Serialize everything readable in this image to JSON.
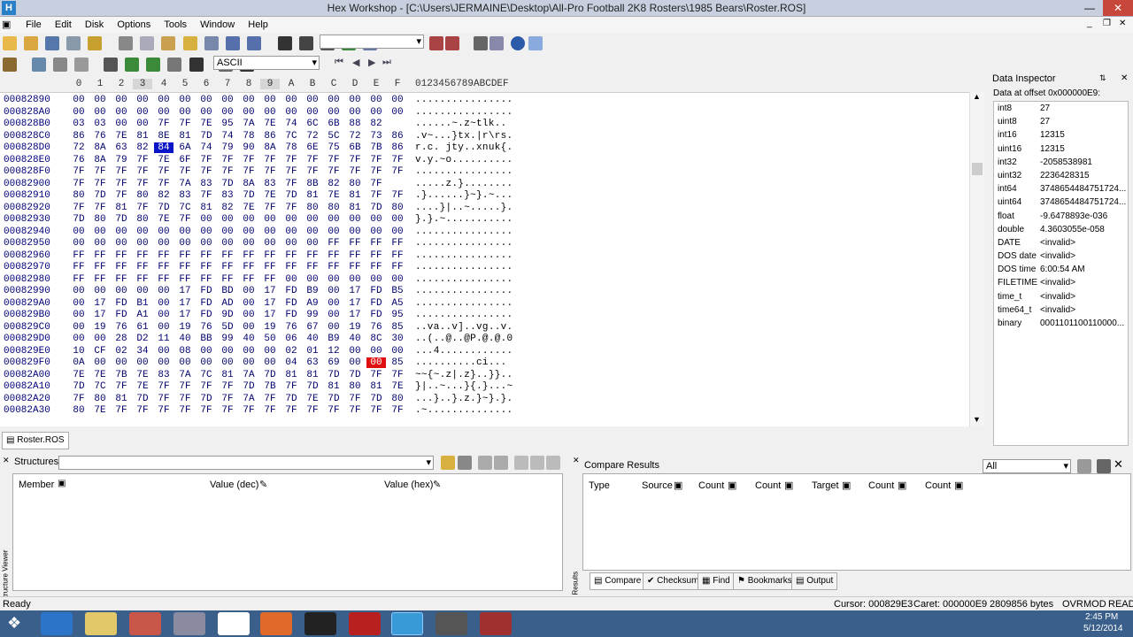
{
  "window": {
    "title": "Hex Workshop - [C:\\Users\\JERMAINE\\Desktop\\All-Pro Football 2K8 Rosters\\1985 Bears\\Roster.ROS]",
    "app_icon": "H"
  },
  "menu": [
    "File",
    "Edit",
    "Disk",
    "Options",
    "Tools",
    "Window",
    "Help"
  ],
  "toolbar2": {
    "encoding": "ASCII"
  },
  "hex": {
    "columns": [
      "0",
      "1",
      "2",
      "3",
      "4",
      "5",
      "6",
      "7",
      "8",
      "9",
      "A",
      "B",
      "C",
      "D",
      "E",
      "F"
    ],
    "ascii_header": "0123456789ABCDEF",
    "rows": [
      {
        "addr": "00082890",
        "b": [
          "00",
          "00",
          "00",
          "00",
          "00",
          "00",
          "00",
          "00",
          "00",
          "00",
          "00",
          "00",
          "00",
          "00",
          "00",
          "00"
        ],
        "a": "................"
      },
      {
        "addr": "000828A0",
        "b": [
          "00",
          "00",
          "00",
          "00",
          "00",
          "00",
          "00",
          "00",
          "00",
          "00",
          "00",
          "00",
          "00",
          "00",
          "00",
          "00"
        ],
        "a": "................"
      },
      {
        "addr": "000828B0",
        "b": [
          "03",
          "03",
          "00",
          "00",
          "7F",
          "7F",
          "7E",
          "95",
          "7A",
          "7E",
          "74",
          "6C",
          "6B",
          "88",
          "82",
          ""
        ],
        "a": "......~.z~tlk.. ",
        "sel": [
          15
        ],
        "asel": [
          15
        ]
      },
      {
        "addr": "000828C0",
        "b": [
          "86",
          "76",
          "7E",
          "81",
          "8E",
          "81",
          "7D",
          "74",
          "78",
          "86",
          "7C",
          "72",
          "5C",
          "72",
          "73",
          "86"
        ],
        "a": ".v~...}tx.|r\\rs."
      },
      {
        "addr": "000828D0",
        "b": [
          "72",
          "8A",
          "63",
          "82",
          "84",
          "6A",
          "74",
          "79",
          "90",
          "8A",
          "78",
          "6E",
          "75",
          "6B",
          "7B",
          "86"
        ],
        "a": "r.c. jty..xnuk{.",
        "sel": [
          4
        ],
        "asel": [
          4
        ]
      },
      {
        "addr": "000828E0",
        "b": [
          "76",
          "8A",
          "79",
          "7F",
          "7E",
          "6F",
          "7F",
          "7F",
          "7F",
          "7F",
          "7F",
          "7F",
          "7F",
          "7F",
          "7F",
          "7F"
        ],
        "a": "v.y.~o.........."
      },
      {
        "addr": "000828F0",
        "b": [
          "7F",
          "7F",
          "7F",
          "7F",
          "7F",
          "7F",
          "7F",
          "7F",
          "7F",
          "7F",
          "7F",
          "7F",
          "7F",
          "7F",
          "7F",
          "7F"
        ],
        "a": "................"
      },
      {
        "addr": "00082900",
        "b": [
          "7F",
          "7F",
          "7F",
          "7F",
          "7F",
          "7A",
          "83",
          "7D",
          "8A",
          "83",
          "7F",
          "8B",
          "82",
          "80",
          "7F",
          ""
        ],
        "a": ".....z.}........"
      },
      {
        "addr": "00082910",
        "b": [
          "80",
          "7D",
          "7F",
          "80",
          "82",
          "83",
          "7F",
          "83",
          "7D",
          "7E",
          "7D",
          "81",
          "7E",
          "81",
          "7F",
          "7F"
        ],
        "a": ".}......}~}.~..."
      },
      {
        "addr": "00082920",
        "b": [
          "7F",
          "7F",
          "81",
          "7F",
          "7D",
          "7C",
          "81",
          "82",
          "7E",
          "7F",
          "7F",
          "80",
          "80",
          "81",
          "7D",
          "80"
        ],
        "a": "....}|..~.....}."
      },
      {
        "addr": "00082930",
        "b": [
          "7D",
          "80",
          "7D",
          "80",
          "7E",
          "7F",
          "00",
          "00",
          "00",
          "00",
          "00",
          "00",
          "00",
          "00",
          "00",
          "00"
        ],
        "a": "}.}.~..........."
      },
      {
        "addr": "00082940",
        "b": [
          "00",
          "00",
          "00",
          "00",
          "00",
          "00",
          "00",
          "00",
          "00",
          "00",
          "00",
          "00",
          "00",
          "00",
          "00",
          "00"
        ],
        "a": "................"
      },
      {
        "addr": "00082950",
        "b": [
          "00",
          "00",
          "00",
          "00",
          "00",
          "00",
          "00",
          "00",
          "00",
          "00",
          "00",
          "00",
          "FF",
          "FF",
          "FF",
          "FF"
        ],
        "a": "................"
      },
      {
        "addr": "00082960",
        "b": [
          "FF",
          "FF",
          "FF",
          "FF",
          "FF",
          "FF",
          "FF",
          "FF",
          "FF",
          "FF",
          "FF",
          "FF",
          "FF",
          "FF",
          "FF",
          "FF"
        ],
        "a": "................"
      },
      {
        "addr": "00082970",
        "b": [
          "FF",
          "FF",
          "FF",
          "FF",
          "FF",
          "FF",
          "FF",
          "FF",
          "FF",
          "FF",
          "FF",
          "FF",
          "FF",
          "FF",
          "FF",
          "FF"
        ],
        "a": "................"
      },
      {
        "addr": "00082980",
        "b": [
          "FF",
          "FF",
          "FF",
          "FF",
          "FF",
          "FF",
          "FF",
          "FF",
          "FF",
          "FF",
          "00",
          "00",
          "00",
          "00",
          "00",
          "00"
        ],
        "a": "................"
      },
      {
        "addr": "00082990",
        "b": [
          "00",
          "00",
          "00",
          "00",
          "00",
          "17",
          "FD",
          "BD",
          "00",
          "17",
          "FD",
          "B9",
          "00",
          "17",
          "FD",
          "B5"
        ],
        "a": "................"
      },
      {
        "addr": "000829A0",
        "b": [
          "00",
          "17",
          "FD",
          "B1",
          "00",
          "17",
          "FD",
          "AD",
          "00",
          "17",
          "FD",
          "A9",
          "00",
          "17",
          "FD",
          "A5"
        ],
        "a": "................"
      },
      {
        "addr": "000829B0",
        "b": [
          "00",
          "17",
          "FD",
          "A1",
          "00",
          "17",
          "FD",
          "9D",
          "00",
          "17",
          "FD",
          "99",
          "00",
          "17",
          "FD",
          "95"
        ],
        "a": "................"
      },
      {
        "addr": "000829C0",
        "b": [
          "00",
          "19",
          "76",
          "61",
          "00",
          "19",
          "76",
          "5D",
          "00",
          "19",
          "76",
          "67",
          "00",
          "19",
          "76",
          "85"
        ],
        "a": "..va..v]..vg..v."
      },
      {
        "addr": "000829D0",
        "b": [
          "00",
          "00",
          "28",
          "D2",
          "11",
          "40",
          "BB",
          "99",
          "40",
          "50",
          "06",
          "40",
          "B9",
          "40",
          "8C",
          "30"
        ],
        "a": "..(..@..@P.@.@.0"
      },
      {
        "addr": "000829E0",
        "b": [
          "10",
          "CF",
          "02",
          "34",
          "00",
          "08",
          "00",
          "00",
          "00",
          "00",
          "02",
          "01",
          "12",
          "00",
          "00",
          "00"
        ],
        "a": "...4............"
      },
      {
        "addr": "000829F0",
        "b": [
          "0A",
          "00",
          "00",
          "00",
          "00",
          "00",
          "00",
          "00",
          "00",
          "00",
          "04",
          "63",
          "69",
          "00",
          "00",
          "85",
          "07"
        ],
        "a": "..........ci...",
        "red": [
          14
        ],
        "ared": [
          14
        ]
      },
      {
        "addr": "00082A00",
        "b": [
          "7E",
          "7E",
          "7B",
          "7E",
          "83",
          "7A",
          "7C",
          "81",
          "7A",
          "7D",
          "81",
          "81",
          "7D",
          "7D",
          "7F",
          "7F"
        ],
        "a": "~~{~.z|.z}..}}.."
      },
      {
        "addr": "00082A10",
        "b": [
          "7D",
          "7C",
          "7F",
          "7E",
          "7F",
          "7F",
          "7F",
          "7F",
          "7D",
          "7B",
          "7F",
          "7D",
          "81",
          "80",
          "81",
          "7E"
        ],
        "a": "}|..~...}{.}...~"
      },
      {
        "addr": "00082A20",
        "b": [
          "7F",
          "80",
          "81",
          "7D",
          "7F",
          "7F",
          "7D",
          "7F",
          "7A",
          "7F",
          "7D",
          "7E",
          "7D",
          "7F",
          "7D",
          "80"
        ],
        "a": "...}..}.z.}~}.}."
      },
      {
        "addr": "00082A30",
        "b": [
          "80",
          "7E",
          "7F",
          "7F",
          "7F",
          "7F",
          "7F",
          "7F",
          "7F",
          "7F",
          "7F",
          "7F",
          "7F",
          "7F",
          "7F",
          "7F"
        ],
        "a": ".~.............."
      }
    ]
  },
  "file_tab": "Roster.ROS",
  "inspector": {
    "title": "Data Inspector",
    "offset_label": "Data at offset 0x000000E9:",
    "items": [
      {
        "k": "int8",
        "v": "27"
      },
      {
        "k": "uint8",
        "v": "27"
      },
      {
        "k": "int16",
        "v": "12315"
      },
      {
        "k": "uint16",
        "v": "12315"
      },
      {
        "k": "int32",
        "v": "-2058538981"
      },
      {
        "k": "uint32",
        "v": "2236428315"
      },
      {
        "k": "int64",
        "v": "3748654484751724..."
      },
      {
        "k": "uint64",
        "v": "3748654484751724..."
      },
      {
        "k": "float",
        "v": "-9.6478893e-036"
      },
      {
        "k": "double",
        "v": "4.3603055e-058"
      },
      {
        "k": "DATE",
        "v": "<invalid>"
      },
      {
        "k": "DOS date",
        "v": "<invalid>"
      },
      {
        "k": "DOS time",
        "v": "6:00:54 AM"
      },
      {
        "k": "FILETIME",
        "v": "<invalid>"
      },
      {
        "k": "time_t",
        "v": "<invalid>"
      },
      {
        "k": "time64_t",
        "v": "<invalid>"
      },
      {
        "k": "binary",
        "v": "0001101100110000..."
      }
    ]
  },
  "structures": {
    "title": "Structures",
    "cols": [
      "Member",
      "Value (dec)",
      "Value (hex)"
    ],
    "side_label": "Structure Viewer"
  },
  "compare": {
    "title": "Compare Results",
    "filter": "All",
    "cols": [
      "Type",
      "Source",
      "Count",
      "Count",
      "Target",
      "Count",
      "Count"
    ],
    "tabs": [
      "Compare",
      "Checksum",
      "Find",
      "Bookmarks",
      "Output"
    ],
    "side_label": "Results"
  },
  "status": {
    "ready": "Ready",
    "cursor": "Cursor: 000829E3",
    "caret": "Caret: 000000E9",
    "size": "2809856 bytes",
    "ovr": "OVR",
    "mod": "MOD",
    "read": "READ"
  },
  "taskbar": {
    "time": "2:45 PM",
    "date": "5/12/2014"
  }
}
